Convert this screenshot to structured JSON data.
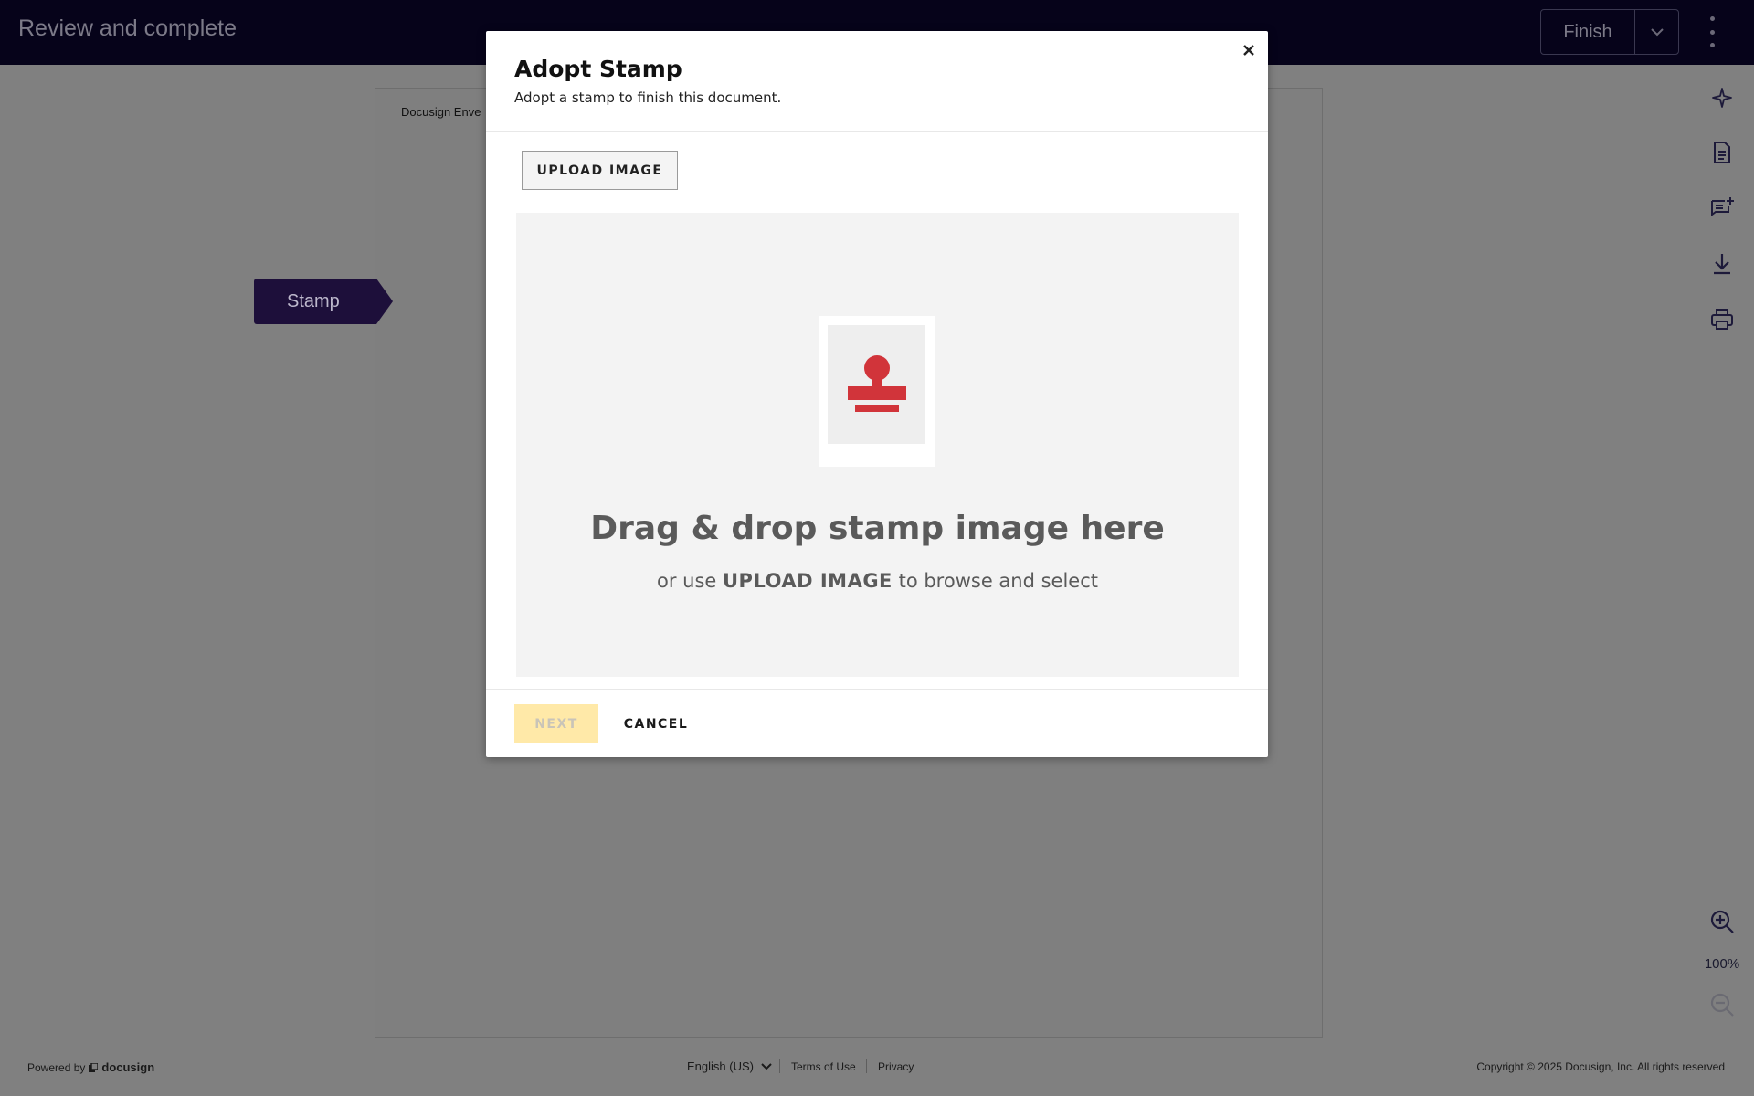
{
  "header": {
    "title": "Review and complete",
    "finish_label": "Finish"
  },
  "document": {
    "header_text": "Docusign Enve",
    "stamp_tag_label": "Stamp"
  },
  "rail": {
    "icons": [
      "sparkle-icon",
      "document-icon",
      "add-comment-icon",
      "download-icon",
      "print-icon",
      "zoom-in-icon",
      "zoom-out-icon"
    ],
    "zoom_level": "100%"
  },
  "modal": {
    "title": "Adopt Stamp",
    "subtitle": "Adopt a stamp to finish this document.",
    "upload_label": "UPLOAD IMAGE",
    "drop_title": "Drag & drop stamp image here",
    "drop_sub_prefix": "or use",
    "drop_sub_emphasis": "UPLOAD IMAGE",
    "drop_sub_suffix": "to browse and select",
    "next_label": "NEXT",
    "cancel_label": "CANCEL",
    "stamp_icon_color": "#d1343a"
  },
  "footer": {
    "powered_by": "Powered by",
    "brand": "docusign",
    "language": "English (US)",
    "terms": "Terms of Use",
    "privacy": "Privacy",
    "copyright": "Copyright © 2025 Docusign, Inc. All rights reserved"
  },
  "colors": {
    "topbar": "#06031a",
    "overlay": "#808080",
    "stamp_tag": "#1d0f3a",
    "next_disabled": "#ffe9a8"
  }
}
